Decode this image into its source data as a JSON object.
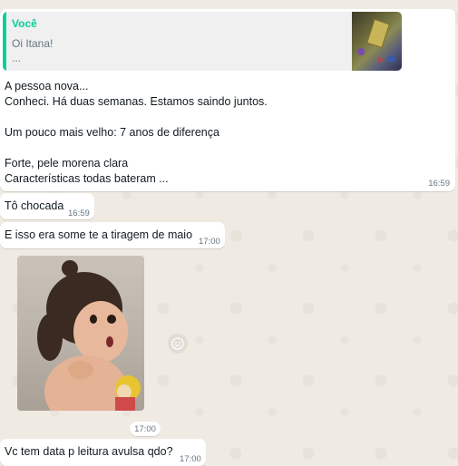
{
  "reply_message": {
    "quote": {
      "author": "Você",
      "line1": "Oi Itana!",
      "line2": "..."
    },
    "lines": [
      "A pessoa nova...",
      "Conheci. Há duas semanas. Estamos saindo juntos.",
      "Um pouco mais velho: 7 anos de diferença",
      "Forte, pele morena clara",
      "Características todas bateram ..."
    ],
    "time": "16:59"
  },
  "messages": [
    {
      "text": "Tô chocada",
      "time": "16:59"
    },
    {
      "text": "E isso era some te a tiragem de maio",
      "time": "17:00"
    }
  ],
  "photo_message": {
    "time": "17:00",
    "react_icon": "smiley-icon"
  },
  "last_message": {
    "text": "Vc tem data p leitura avulsa qdo?",
    "time": "17:00"
  },
  "colors": {
    "background": "#efeae2",
    "bubble": "#ffffff",
    "quote_accent": "#06cf9c",
    "timestamp": "#667781"
  }
}
